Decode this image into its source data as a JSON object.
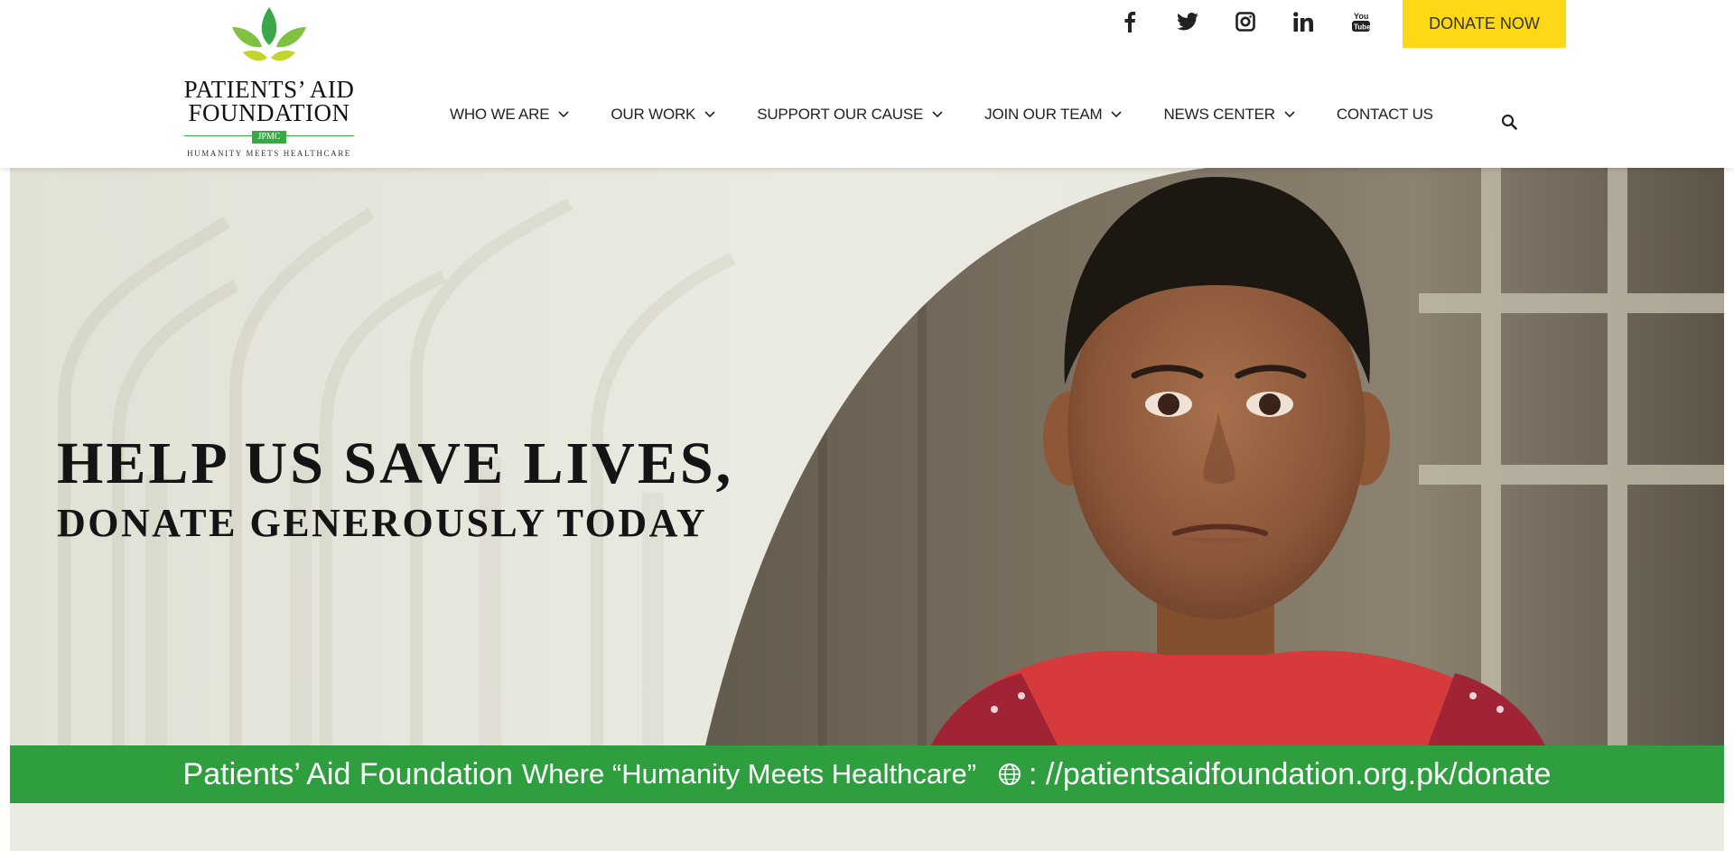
{
  "header": {
    "logo": {
      "name_line1": "PATIENTS’ AID",
      "name_line2": "FOUNDATION",
      "badge": "JPMC",
      "tagline": "HUMANITY MEETS HEALTHCARE"
    },
    "nav": [
      {
        "label": "WHO WE ARE",
        "has_dropdown": true
      },
      {
        "label": "OUR WORK",
        "has_dropdown": true
      },
      {
        "label": "SUPPORT OUR CAUSE",
        "has_dropdown": true
      },
      {
        "label": "JOIN OUR TEAM",
        "has_dropdown": true
      },
      {
        "label": "NEWS CENTER",
        "has_dropdown": true
      },
      {
        "label": "CONTACT US",
        "has_dropdown": false
      }
    ],
    "social_icons": [
      "facebook-icon",
      "twitter-icon",
      "instagram-icon",
      "linkedin-icon",
      "youtube-icon"
    ],
    "donate_label": "DONATE NOW",
    "search_icon": "search-icon"
  },
  "hero": {
    "headline_line1": "HELP US SAVE LIVES,",
    "headline_line2": "DONATE GENEROUSLY TODAY",
    "banner_part1": "Patients’ Aid Foundation",
    "banner_part2": "Where “Humanity Meets Healthcare”",
    "banner_url": ": //patientsaidfoundation.org.pk/donate"
  },
  "colors": {
    "donate_bg": "#fcd817",
    "banner_green": "#2f9e3f",
    "logo_green": "#3aa847",
    "nav_text": "#222222"
  }
}
